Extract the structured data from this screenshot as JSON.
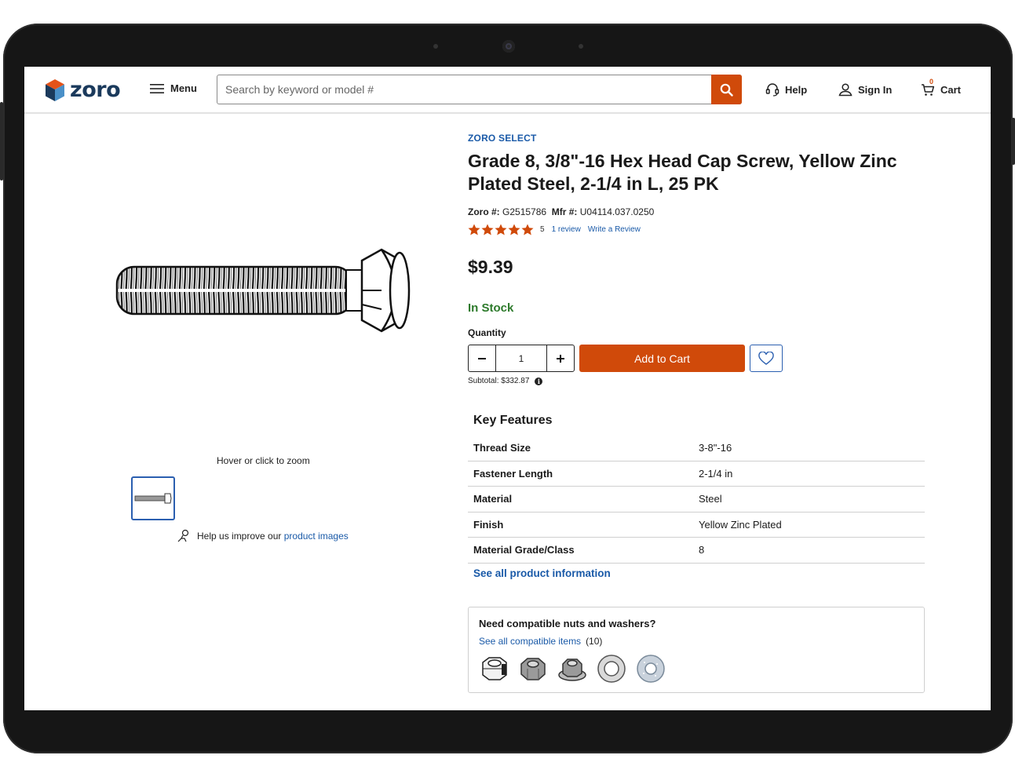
{
  "header": {
    "logo_text": "zoro",
    "menu_label": "Menu",
    "search_placeholder": "Search by keyword or model #",
    "help_label": "Help",
    "signin_label": "Sign In",
    "cart_label": "Cart",
    "cart_count": "0"
  },
  "gallery": {
    "zoom_hint": "Hover or click to zoom",
    "improve_text": "Help us improve our",
    "improve_link": "product images"
  },
  "product": {
    "brand": "ZORO SELECT",
    "title": "Grade 8, 3/8\"-16 Hex Head Cap Screw, Yellow Zinc Plated Steel, 2-1/4 in L, 25 PK",
    "zoro_label": "Zoro #:",
    "zoro_number": "G2515786",
    "mfr_label": "Mfr #:",
    "mfr_number": "U04114.037.0250",
    "rating": 5,
    "rating_text": "5",
    "review_count": "1 review",
    "write_review": "Write a Review",
    "price": "$9.39",
    "stock_status": "In Stock",
    "quantity_label": "Quantity",
    "quantity": "1",
    "add_to_cart": "Add to Cart",
    "subtotal": "Subtotal: $332.87"
  },
  "key_features": {
    "title": "Key Features",
    "rows": [
      {
        "label": "Thread Size",
        "value": "3-8\"-16"
      },
      {
        "label": "Fastener Length",
        "value": "2-1/4 in"
      },
      {
        "label": "Material",
        "value": "Steel"
      },
      {
        "label": "Finish",
        "value": "Yellow Zinc Plated"
      },
      {
        "label": "Material Grade/Class",
        "value": "8"
      }
    ],
    "see_all": "See all product information"
  },
  "compatible": {
    "title": "Need compatible nuts and washers?",
    "link": "See all compatible items",
    "count": "(10)",
    "items": [
      "nylon-lock-nut-icon",
      "hex-nut-icon",
      "flange-nut-icon",
      "flat-washer-icon",
      "lock-washer-icon"
    ]
  },
  "colors": {
    "accent": "#d04a0a",
    "link": "#1a5aa8",
    "stock": "#2d7a2b",
    "logo": "#1b3a5c"
  }
}
